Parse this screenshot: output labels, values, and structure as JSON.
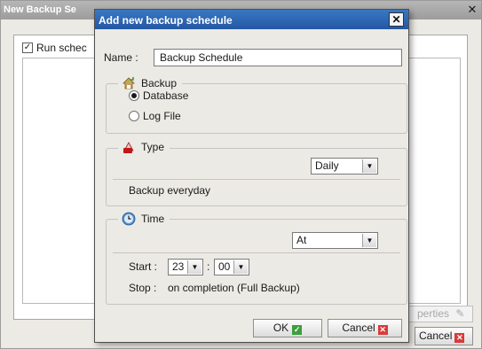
{
  "background_window": {
    "title": "New Backup Se",
    "close_glyph": "✕",
    "run_schedule_label": "Run schec",
    "run_schedule_checked": true,
    "properties_label": "perties",
    "cancel_label": "Cancel"
  },
  "dialog": {
    "title": "Add new backup schedule",
    "close_glyph": "✕",
    "name_label": "Name :",
    "name_value": "Backup Schedule",
    "backup_group": {
      "legend": "Backup",
      "icon": "backup-icon",
      "options": [
        {
          "label": "Database",
          "selected": true
        },
        {
          "label": "Log File",
          "selected": false
        }
      ]
    },
    "type_group": {
      "legend": "Type",
      "icon": "type-icon",
      "frequency": "Daily",
      "description": "Backup everyday"
    },
    "time_group": {
      "legend": "Time",
      "icon": "clock-icon",
      "mode": "At",
      "start_label": "Start :",
      "start_hour": "23",
      "time_separator": ":",
      "start_minute": "00",
      "stop_label": "Stop :",
      "stop_value": "on completion (Full Backup)"
    },
    "ok_label": "OK",
    "cancel_label": "Cancel"
  },
  "colors": {
    "dialog_title": "#2457a4",
    "ok_icon": "#3d9e3d",
    "cancel_icon": "#d93a3a"
  }
}
